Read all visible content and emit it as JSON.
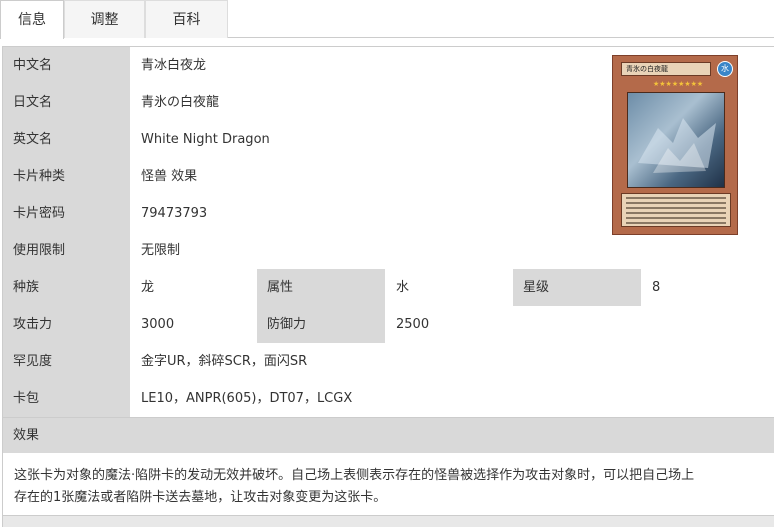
{
  "tabs": [
    {
      "label": "信息",
      "active": true
    },
    {
      "label": "调整",
      "active": false
    },
    {
      "label": "百科",
      "active": false
    }
  ],
  "card": {
    "cn_name_label": "中文名",
    "cn_name": "青冰白夜龙",
    "jp_name_label": "日文名",
    "jp_name": "青氷の白夜龍",
    "en_name_label": "英文名",
    "en_name": "White Night Dragon",
    "type_label": "卡片种类",
    "type": "怪兽 效果",
    "password_label": "卡片密码",
    "password": "79473793",
    "limit_label": "使用限制",
    "limit": "无限制",
    "race_label": "种族",
    "race": "龙",
    "attribute_label": "属性",
    "attribute": "水",
    "level_label": "星级",
    "level": "8",
    "atk_label": "攻击力",
    "atk": "3000",
    "def_label": "防御力",
    "def": "2500",
    "rarity_label": "罕见度",
    "rarity": "金字UR，斜碎SCR，面闪SR",
    "pack_label": "卡包",
    "pack": "LE10，ANPR(605)，DT07，LCGX",
    "effect_label": "效果",
    "effect_line1": "这张卡为对象的魔法·陷阱卡的发动无效并破坏。自己场上表侧表示存在的怪兽被选择作为攻击对象时，可以把自己场上",
    "effect_line2": "存在的1张魔法或者陷阱卡送去墓地，让攻击对象变更为这张卡。"
  },
  "card_image": {
    "title": "青氷の白夜龍",
    "attribute_glyph": "水",
    "stars": "★★★★★★★★",
    "icon": "card-artwork"
  },
  "colors": {
    "label_bg": "#d9d9d9",
    "border": "#cccccc",
    "card_frame": "#b46a4a"
  }
}
